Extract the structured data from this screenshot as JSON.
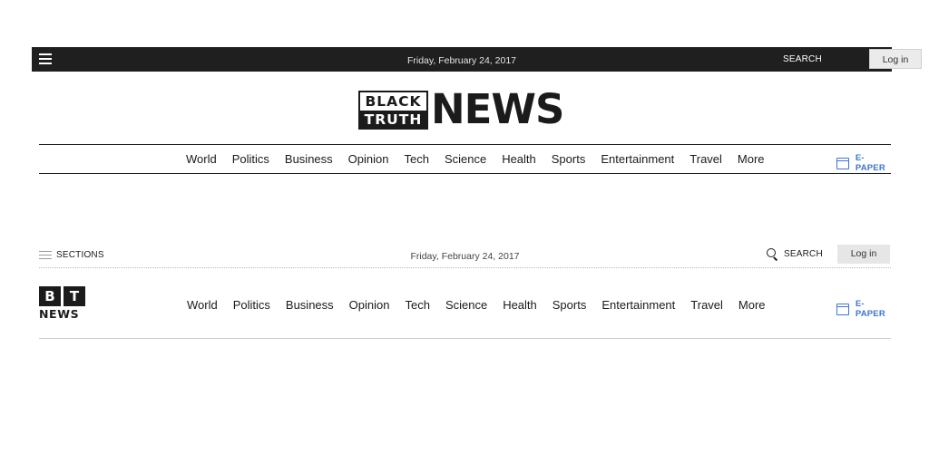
{
  "header_primary": {
    "date": "Friday, February 24, 2017",
    "search_label": "SEARCH",
    "login_label": "Log in",
    "menu_icon": "hamburger-icon",
    "masthead": {
      "line1": "BLACK",
      "line2": "TRUTH",
      "wordmark": "NEWS"
    },
    "nav_items": [
      "World",
      "Politics",
      "Business",
      "Opinion",
      "Tech",
      "Science",
      "Health",
      "Sports",
      "Entertainment",
      "Travel",
      "More"
    ],
    "epaper_label": "E-PAPER",
    "epaper_icon": "newspaper-icon"
  },
  "header_compact": {
    "sections_label": "SECTIONS",
    "sections_icon": "hamburger-icon",
    "date": "Friday, February 24, 2017",
    "search_label": "SEARCH",
    "search_icon": "search-icon",
    "login_label": "Log in",
    "logo": {
      "letter1": "B",
      "letter2": "T",
      "wordmark": "NEWS"
    },
    "nav_items": [
      "World",
      "Politics",
      "Business",
      "Opinion",
      "Tech",
      "Science",
      "Health",
      "Sports",
      "Entertainment",
      "Travel",
      "More"
    ],
    "epaper_label": "E-PAPER",
    "epaper_icon": "newspaper-icon"
  },
  "colors": {
    "topbar_bg": "#1f1f1f",
    "accent_blue": "#3d74d4",
    "text": "#1b1b1b"
  }
}
